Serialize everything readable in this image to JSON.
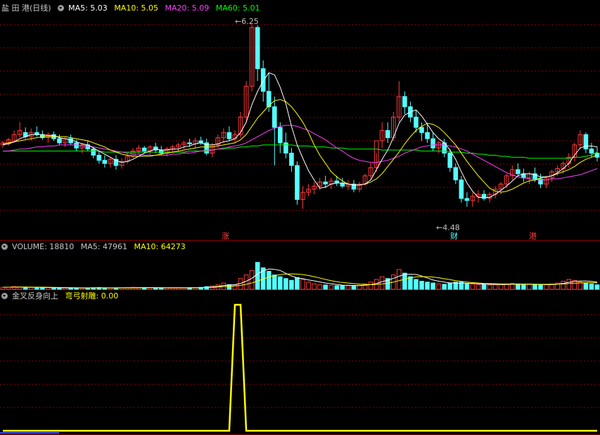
{
  "header": {
    "stock_name": "盐 田 港",
    "period": "(日线)",
    "ma5": "MA5: 5.03",
    "ma10": "MA10: 5.05",
    "ma20": "MA20: 5.09",
    "ma60": "MA60: 5.01"
  },
  "volume": {
    "label": "VOLUME: 18810",
    "ma5": "MA5: 47961",
    "ma10": "MA10: 64273"
  },
  "indicator": {
    "name": "金叉反身向上",
    "field": "弯弓射雕: 0.00"
  },
  "annotations": {
    "high": "6.25",
    "low": "4.48",
    "marker_zhang": "涨",
    "marker_cai": "财",
    "marker_gang": "港"
  },
  "colors": {
    "up": "#ff3b3b",
    "down": "#55ffff",
    "ma5": "#ffffff",
    "ma10": "#ffff00",
    "ma20": "#ff40ff",
    "ma60": "#00ff00",
    "grid": "#8b0000",
    "signal": "#ffff00"
  },
  "chart_data": {
    "type": "candlestick",
    "candles": [
      [
        5.08,
        5.12,
        5.05,
        5.1
      ],
      [
        5.1,
        5.15,
        5.07,
        5.13
      ],
      [
        5.12,
        5.22,
        5.1,
        5.18
      ],
      [
        5.18,
        5.3,
        5.15,
        5.22
      ],
      [
        5.2,
        5.25,
        5.14,
        5.16
      ],
      [
        5.16,
        5.24,
        5.12,
        5.2
      ],
      [
        5.2,
        5.26,
        5.16,
        5.18
      ],
      [
        5.18,
        5.22,
        5.13,
        5.15
      ],
      [
        5.15,
        5.2,
        5.1,
        5.18
      ],
      [
        5.18,
        5.21,
        5.12,
        5.14
      ],
      [
        5.14,
        5.18,
        5.08,
        5.1
      ],
      [
        5.1,
        5.16,
        5.06,
        5.14
      ],
      [
        5.14,
        5.18,
        5.08,
        5.1
      ],
      [
        5.1,
        5.13,
        5.02,
        5.05
      ],
      [
        5.05,
        5.1,
        5.0,
        5.08
      ],
      [
        5.08,
        5.12,
        5.02,
        5.04
      ],
      [
        5.04,
        5.06,
        4.95,
        4.98
      ],
      [
        4.98,
        5.02,
        4.9,
        4.93
      ],
      [
        4.93,
        4.98,
        4.86,
        4.9
      ],
      [
        4.9,
        4.96,
        4.86,
        4.94
      ],
      [
        4.94,
        4.98,
        4.84,
        4.88
      ],
      [
        4.88,
        4.95,
        4.85,
        4.92
      ],
      [
        4.92,
        5.0,
        4.9,
        4.97
      ],
      [
        4.97,
        5.05,
        4.95,
        5.02
      ],
      [
        5.02,
        5.08,
        4.99,
        5.05
      ],
      [
        5.05,
        5.07,
        5.0,
        5.02
      ],
      [
        5.02,
        5.08,
        4.98,
        5.06
      ],
      [
        5.06,
        5.1,
        5.0,
        5.03
      ],
      [
        5.03,
        5.07,
        4.98,
        5.0
      ],
      [
        5.0,
        5.06,
        4.97,
        5.04
      ],
      [
        5.04,
        5.08,
        5.0,
        5.06
      ],
      [
        5.06,
        5.1,
        5.02,
        5.08
      ],
      [
        5.08,
        5.12,
        5.04,
        5.1
      ],
      [
        5.1,
        5.14,
        5.06,
        5.09
      ],
      [
        5.09,
        5.15,
        5.05,
        5.12
      ],
      [
        5.12,
        5.16,
        5.08,
        5.1
      ],
      [
        5.1,
        5.14,
        4.98,
        5.0
      ],
      [
        5.0,
        5.1,
        4.96,
        5.08
      ],
      [
        5.08,
        5.18,
        5.05,
        5.15
      ],
      [
        5.15,
        5.24,
        5.1,
        5.2
      ],
      [
        5.2,
        5.26,
        5.12,
        5.14
      ],
      [
        5.14,
        5.22,
        5.1,
        5.18
      ],
      [
        5.18,
        5.4,
        5.15,
        5.35
      ],
      [
        5.35,
        5.7,
        5.3,
        5.65
      ],
      [
        5.65,
        6.25,
        5.6,
        6.22
      ],
      [
        6.22,
        6.24,
        5.7,
        5.82
      ],
      [
        5.82,
        5.9,
        5.5,
        5.6
      ],
      [
        5.6,
        5.78,
        5.4,
        5.45
      ],
      [
        5.45,
        5.55,
        4.88,
        5.25
      ],
      [
        5.25,
        5.3,
        5.0,
        5.1
      ],
      [
        5.1,
        5.2,
        4.95,
        5.0
      ],
      [
        5.0,
        5.05,
        4.82,
        4.88
      ],
      [
        4.88,
        4.92,
        4.5,
        4.55
      ],
      [
        4.55,
        4.68,
        4.46,
        4.62
      ],
      [
        4.62,
        4.7,
        4.58,
        4.65
      ],
      [
        4.65,
        4.72,
        4.6,
        4.68
      ],
      [
        4.68,
        4.76,
        4.64,
        4.72
      ],
      [
        4.72,
        4.78,
        4.66,
        4.7
      ],
      [
        4.7,
        4.76,
        4.65,
        4.73
      ],
      [
        4.73,
        4.78,
        4.68,
        4.71
      ],
      [
        4.71,
        4.76,
        4.66,
        4.68
      ],
      [
        4.68,
        4.74,
        4.64,
        4.7
      ],
      [
        4.7,
        4.74,
        4.62,
        4.65
      ],
      [
        4.65,
        4.72,
        4.62,
        4.7
      ],
      [
        4.7,
        4.8,
        4.68,
        4.78
      ],
      [
        4.78,
        4.9,
        4.74,
        4.86
      ],
      [
        4.86,
        5.0,
        4.82,
        5.12
      ],
      [
        5.12,
        5.3,
        5.05,
        5.22
      ],
      [
        5.22,
        5.3,
        5.1,
        5.15
      ],
      [
        5.15,
        5.4,
        5.12,
        5.35
      ],
      [
        5.35,
        5.7,
        5.3,
        5.55
      ],
      [
        5.55,
        5.6,
        5.38,
        5.45
      ],
      [
        5.45,
        5.5,
        5.3,
        5.35
      ],
      [
        5.35,
        5.42,
        5.2,
        5.25
      ],
      [
        5.25,
        5.3,
        5.12,
        5.2
      ],
      [
        5.2,
        5.28,
        5.1,
        5.14
      ],
      [
        5.14,
        5.2,
        5.02,
        5.05
      ],
      [
        5.05,
        5.12,
        5.0,
        5.1
      ],
      [
        5.1,
        5.14,
        4.96,
        5.0
      ],
      [
        5.0,
        5.04,
        4.82,
        4.86
      ],
      [
        4.86,
        4.9,
        4.7,
        4.74
      ],
      [
        4.74,
        4.78,
        4.52,
        4.56
      ],
      [
        4.56,
        4.62,
        4.48,
        4.54
      ],
      [
        4.54,
        4.62,
        4.48,
        4.58
      ],
      [
        4.58,
        4.64,
        4.52,
        4.6
      ],
      [
        4.6,
        4.64,
        4.54,
        4.56
      ],
      [
        4.56,
        4.62,
        4.52,
        4.6
      ],
      [
        4.6,
        4.68,
        4.56,
        4.65
      ],
      [
        4.65,
        4.72,
        4.6,
        4.7
      ],
      [
        4.7,
        4.8,
        4.66,
        4.78
      ],
      [
        4.78,
        4.88,
        4.74,
        4.84
      ],
      [
        4.84,
        4.9,
        4.78,
        4.8
      ],
      [
        4.8,
        4.85,
        4.72,
        4.76
      ],
      [
        4.76,
        4.82,
        4.7,
        4.8
      ],
      [
        4.8,
        4.86,
        4.72,
        4.75
      ],
      [
        4.75,
        4.8,
        4.66,
        4.7
      ],
      [
        4.7,
        4.78,
        4.66,
        4.76
      ],
      [
        4.76,
        4.84,
        4.72,
        4.82
      ],
      [
        4.82,
        4.88,
        4.78,
        4.85
      ],
      [
        4.85,
        4.92,
        4.8,
        4.9
      ],
      [
        4.9,
        5.0,
        4.86,
        4.96
      ],
      [
        4.96,
        5.1,
        4.92,
        5.08
      ],
      [
        5.08,
        5.22,
        5.04,
        5.18
      ],
      [
        5.18,
        5.2,
        5.0,
        5.04
      ],
      [
        5.04,
        5.1,
        4.96,
        5.0
      ],
      [
        5.0,
        5.06,
        4.92,
        4.96
      ]
    ],
    "ma5": [
      5.08,
      5.09,
      5.11,
      5.14,
      5.16,
      5.18,
      5.18,
      5.18,
      5.17,
      5.17,
      5.15,
      5.14,
      5.13,
      5.11,
      5.09,
      5.08,
      5.05,
      5.02,
      4.99,
      4.96,
      4.93,
      4.91,
      4.92,
      4.94,
      4.97,
      5.0,
      5.02,
      5.04,
      5.03,
      5.03,
      5.04,
      5.04,
      5.06,
      5.07,
      5.09,
      5.1,
      5.08,
      5.08,
      5.09,
      5.11,
      5.12,
      5.14,
      5.2,
      5.3,
      5.47,
      5.6,
      5.7,
      5.78,
      5.76,
      5.64,
      5.48,
      5.26,
      5.08,
      4.95,
      4.83,
      4.74,
      4.66,
      4.67,
      4.7,
      4.71,
      4.71,
      4.7,
      4.69,
      4.69,
      4.7,
      4.74,
      4.84,
      4.94,
      5.03,
      5.15,
      5.29,
      5.37,
      5.4,
      5.42,
      5.36,
      5.28,
      5.2,
      5.14,
      5.1,
      5.03,
      4.94,
      4.82,
      4.71,
      4.63,
      4.57,
      4.57,
      4.57,
      4.6,
      4.64,
      4.68,
      4.73,
      4.78,
      4.8,
      4.8,
      4.79,
      4.77,
      4.77,
      4.78,
      4.81,
      4.85,
      4.9,
      4.98,
      5.05,
      5.07,
      5.07,
      5.06
    ],
    "ma10": [
      5.09,
      5.1,
      5.11,
      5.12,
      5.13,
      5.14,
      5.15,
      5.16,
      5.16,
      5.16,
      5.16,
      5.16,
      5.15,
      5.14,
      5.13,
      5.12,
      5.1,
      5.08,
      5.06,
      5.03,
      5.01,
      4.99,
      4.98,
      4.97,
      4.97,
      4.97,
      4.97,
      4.98,
      4.99,
      5.0,
      5.01,
      5.02,
      5.03,
      5.04,
      5.05,
      5.06,
      5.06,
      5.06,
      5.07,
      5.08,
      5.09,
      5.1,
      5.13,
      5.18,
      5.26,
      5.34,
      5.4,
      5.46,
      5.51,
      5.52,
      5.5,
      5.45,
      5.38,
      5.3,
      5.2,
      5.08,
      4.98,
      4.9,
      4.82,
      4.77,
      4.73,
      4.7,
      4.69,
      4.69,
      4.7,
      4.72,
      4.75,
      4.8,
      4.87,
      4.94,
      5.01,
      5.09,
      5.16,
      5.22,
      5.26,
      5.29,
      5.28,
      5.25,
      5.2,
      5.14,
      5.08,
      5.0,
      4.92,
      4.85,
      4.78,
      4.72,
      4.66,
      4.63,
      4.62,
      4.63,
      4.65,
      4.68,
      4.71,
      4.73,
      4.74,
      4.76,
      4.77,
      4.78,
      4.8,
      4.82,
      4.84,
      4.87,
      4.91,
      4.94,
      4.96,
      4.98
    ],
    "ma20": [
      5.02,
      5.02,
      5.03,
      5.04,
      5.04,
      5.05,
      5.06,
      5.06,
      5.07,
      5.07,
      5.08,
      5.08,
      5.08,
      5.08,
      5.07,
      5.07,
      5.06,
      5.05,
      5.04,
      5.03,
      5.02,
      5.01,
      5.0,
      4.99,
      4.99,
      4.98,
      4.98,
      4.98,
      4.98,
      4.98,
      4.99,
      4.99,
      5.0,
      5.0,
      5.01,
      5.02,
      5.02,
      5.03,
      5.04,
      5.05,
      5.06,
      5.07,
      5.08,
      5.1,
      5.13,
      5.16,
      5.19,
      5.22,
      5.24,
      5.26,
      5.27,
      5.27,
      5.26,
      5.24,
      5.22,
      5.19,
      5.16,
      5.13,
      5.09,
      5.05,
      5.02,
      4.98,
      4.95,
      4.93,
      4.92,
      4.91,
      4.91,
      4.92,
      4.93,
      4.95,
      4.97,
      5.0,
      5.02,
      5.04,
      5.06,
      5.07,
      5.08,
      5.08,
      5.08,
      5.07,
      5.06,
      5.04,
      5.02,
      4.99,
      4.96,
      4.93,
      4.9,
      4.87,
      4.84,
      4.81,
      4.79,
      4.77,
      4.76,
      4.75,
      4.74,
      4.74,
      4.74,
      4.75,
      4.75,
      4.76,
      4.77,
      4.78,
      4.79,
      4.81,
      4.83,
      4.85
    ],
    "ma60": [
      5.02,
      5.02,
      5.02,
      5.02,
      5.02,
      5.02,
      5.02,
      5.02,
      5.02,
      5.02,
      5.02,
      5.02,
      5.02,
      5.02,
      5.02,
      5.02,
      5.02,
      5.02,
      5.01,
      5.01,
      5.01,
      5.01,
      5.01,
      5.01,
      5.01,
      5.01,
      5.01,
      5.01,
      5.01,
      5.01,
      5.01,
      5.01,
      5.01,
      5.02,
      5.02,
      5.02,
      5.03,
      5.03,
      5.04,
      5.04,
      5.05,
      5.05,
      5.06,
      5.06,
      5.07,
      5.07,
      5.08,
      5.08,
      5.08,
      5.08,
      5.08,
      5.08,
      5.07,
      5.07,
      5.07,
      5.06,
      5.06,
      5.06,
      5.05,
      5.05,
      5.05,
      5.04,
      5.04,
      5.04,
      5.04,
      5.04,
      5.04,
      5.03,
      5.03,
      5.03,
      5.03,
      5.03,
      5.03,
      5.03,
      5.02,
      5.02,
      5.02,
      5.02,
      5.02,
      5.01,
      5.01,
      5.01,
      5.0,
      5.0,
      4.99,
      4.99,
      4.98,
      4.98,
      4.97,
      4.97,
      4.96,
      4.96,
      4.96,
      4.95,
      4.95,
      4.95,
      4.95,
      4.95,
      4.95,
      4.95,
      4.95,
      4.96,
      4.96,
      4.97,
      4.98,
      5.01
    ],
    "price_range": [
      4.3,
      6.35
    ],
    "volume": [
      22,
      24,
      30,
      26,
      22,
      20,
      18,
      18,
      20,
      18,
      16,
      16,
      15,
      14,
      15,
      14,
      18,
      20,
      16,
      14,
      16,
      18,
      20,
      22,
      20,
      18,
      18,
      16,
      15,
      16,
      18,
      18,
      16,
      18,
      20,
      22,
      30,
      38,
      50,
      70,
      52,
      48,
      120,
      160,
      210,
      300,
      240,
      200,
      160,
      140,
      120,
      100,
      130,
      110,
      80,
      60,
      50,
      48,
      44,
      40,
      42,
      40,
      38,
      44,
      60,
      80,
      110,
      140,
      120,
      160,
      220,
      180,
      140,
      110,
      90,
      80,
      70,
      60,
      56,
      70,
      80,
      80,
      60,
      56,
      50,
      52,
      48,
      50,
      58,
      60,
      66,
      60,
      54,
      56,
      50,
      48,
      52,
      58,
      70,
      90,
      110,
      100,
      80,
      70,
      60,
      50
    ],
    "vol_ma5": [
      24,
      24,
      25,
      25,
      25,
      24,
      23,
      22,
      20,
      19,
      18,
      17,
      16,
      16,
      15,
      15,
      16,
      17,
      17,
      16,
      17,
      17,
      17,
      18,
      19,
      20,
      20,
      19,
      18,
      17,
      17,
      17,
      17,
      17,
      18,
      19,
      22,
      26,
      32,
      42,
      48,
      52,
      66,
      90,
      122,
      170,
      206,
      226,
      222,
      210,
      178,
      148,
      128,
      118,
      104,
      94,
      82,
      70,
      62,
      54,
      46,
      45,
      43,
      41,
      45,
      53,
      64,
      85,
      100,
      122,
      146,
      166,
      168,
      166,
      148,
      126,
      104,
      90,
      80,
      72,
      70,
      68,
      68,
      66,
      62,
      58,
      56,
      55,
      53,
      54,
      56,
      57,
      58,
      58,
      57,
      55,
      52,
      53,
      57,
      66,
      78,
      88,
      92,
      92,
      88,
      80
    ],
    "vol_ma10": [
      24,
      24,
      24,
      25,
      25,
      25,
      24,
      24,
      23,
      22,
      21,
      20,
      19,
      18,
      17,
      17,
      17,
      17,
      17,
      17,
      17,
      17,
      17,
      17,
      17,
      18,
      18,
      18,
      18,
      18,
      18,
      18,
      18,
      18,
      18,
      18,
      20,
      22,
      25,
      30,
      33,
      37,
      44,
      56,
      71,
      90,
      114,
      136,
      152,
      164,
      170,
      172,
      170,
      164,
      154,
      140,
      126,
      110,
      96,
      84,
      76,
      70,
      64,
      58,
      54,
      52,
      54,
      60,
      68,
      80,
      96,
      112,
      128,
      138,
      140,
      140,
      136,
      128,
      118,
      108,
      96,
      88,
      80,
      75,
      70,
      66,
      64,
      62,
      60,
      59,
      58,
      58,
      58,
      57,
      56,
      56,
      56,
      57,
      58,
      60,
      64,
      68,
      72,
      74,
      74,
      72
    ],
    "vol_range": [
      0,
      400
    ],
    "signal": [
      0,
      0,
      0,
      0,
      0,
      0,
      0,
      0,
      0,
      0,
      0,
      0,
      0,
      0,
      0,
      0,
      0,
      0,
      0,
      0,
      0,
      0,
      0,
      0,
      0,
      0,
      0,
      0,
      0,
      0,
      0,
      0,
      0,
      0,
      0,
      0,
      0,
      0,
      0,
      0,
      0,
      1,
      1,
      0,
      0,
      0,
      0,
      0,
      0,
      0,
      0,
      0,
      0,
      0,
      0,
      0,
      0,
      0,
      0,
      0,
      0,
      0,
      0,
      0,
      0,
      0,
      0,
      0,
      0,
      0,
      0,
      0,
      0,
      0,
      0,
      0,
      0,
      0,
      0,
      0,
      0,
      0,
      0,
      0,
      0,
      0,
      0,
      0,
      0,
      0,
      0,
      0,
      0,
      0,
      0,
      0,
      0,
      0,
      0,
      0,
      0,
      0,
      0,
      0,
      0,
      0
    ]
  }
}
